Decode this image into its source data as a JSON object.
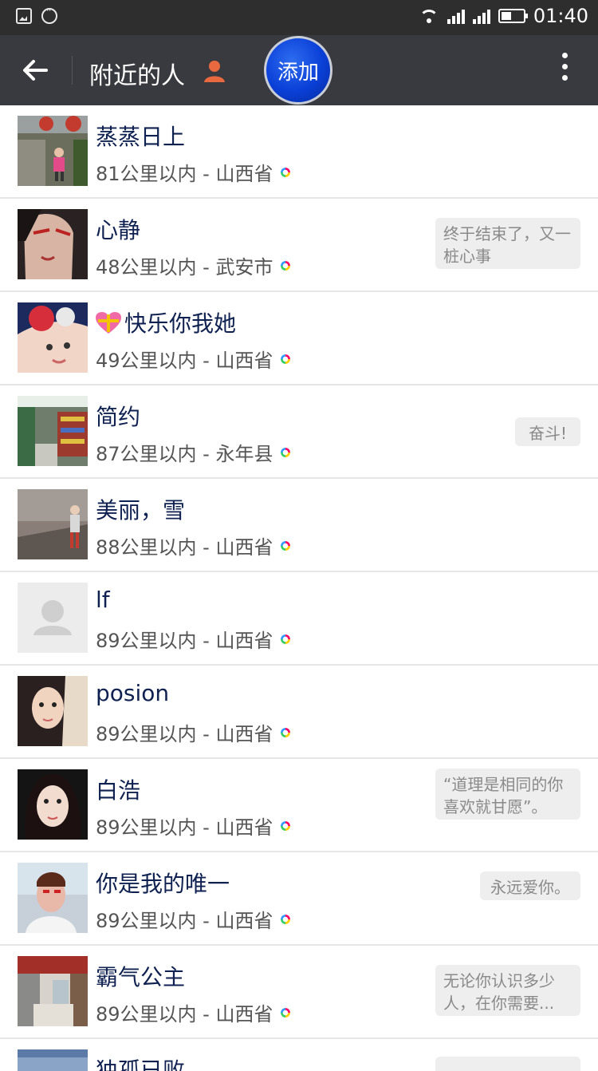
{
  "status_bar": {
    "time": "01:40"
  },
  "header": {
    "title": "附近的人",
    "add_button": "添加"
  },
  "people": [
    {
      "name": "蒸蒸日上",
      "distance": "81公里以内 - 山西省",
      "signature": ""
    },
    {
      "name": "心静",
      "distance": "48公里以内 - 武安市",
      "signature": "终于结束了，又一桩心事"
    },
    {
      "name": "快乐你我她",
      "distance": "49公里以内 - 山西省",
      "signature": ""
    },
    {
      "name": "简约",
      "distance": "87公里以内 - 永年县",
      "signature": "奋斗!"
    },
    {
      "name": "美丽，雪",
      "distance": "88公里以内 - 山西省",
      "signature": ""
    },
    {
      "name": "lf",
      "distance": "89公里以内 - 山西省",
      "signature": ""
    },
    {
      "name": "posion",
      "distance": "89公里以内 - 山西省",
      "signature": ""
    },
    {
      "name": "白浩",
      "distance": "89公里以内 - 山西省",
      "signature": "“道理是相同的你喜欢就甘愿”。"
    },
    {
      "name": "你是我的唯一",
      "distance": "89公里以内 - 山西省",
      "signature": "永远爱你。"
    },
    {
      "name": "霸气公主",
      "distance": "89公里以内 - 山西省",
      "signature": "无论你认识多少人，在你需要..."
    },
    {
      "name": "独孤已败",
      "distance": "",
      "signature": ""
    }
  ]
}
